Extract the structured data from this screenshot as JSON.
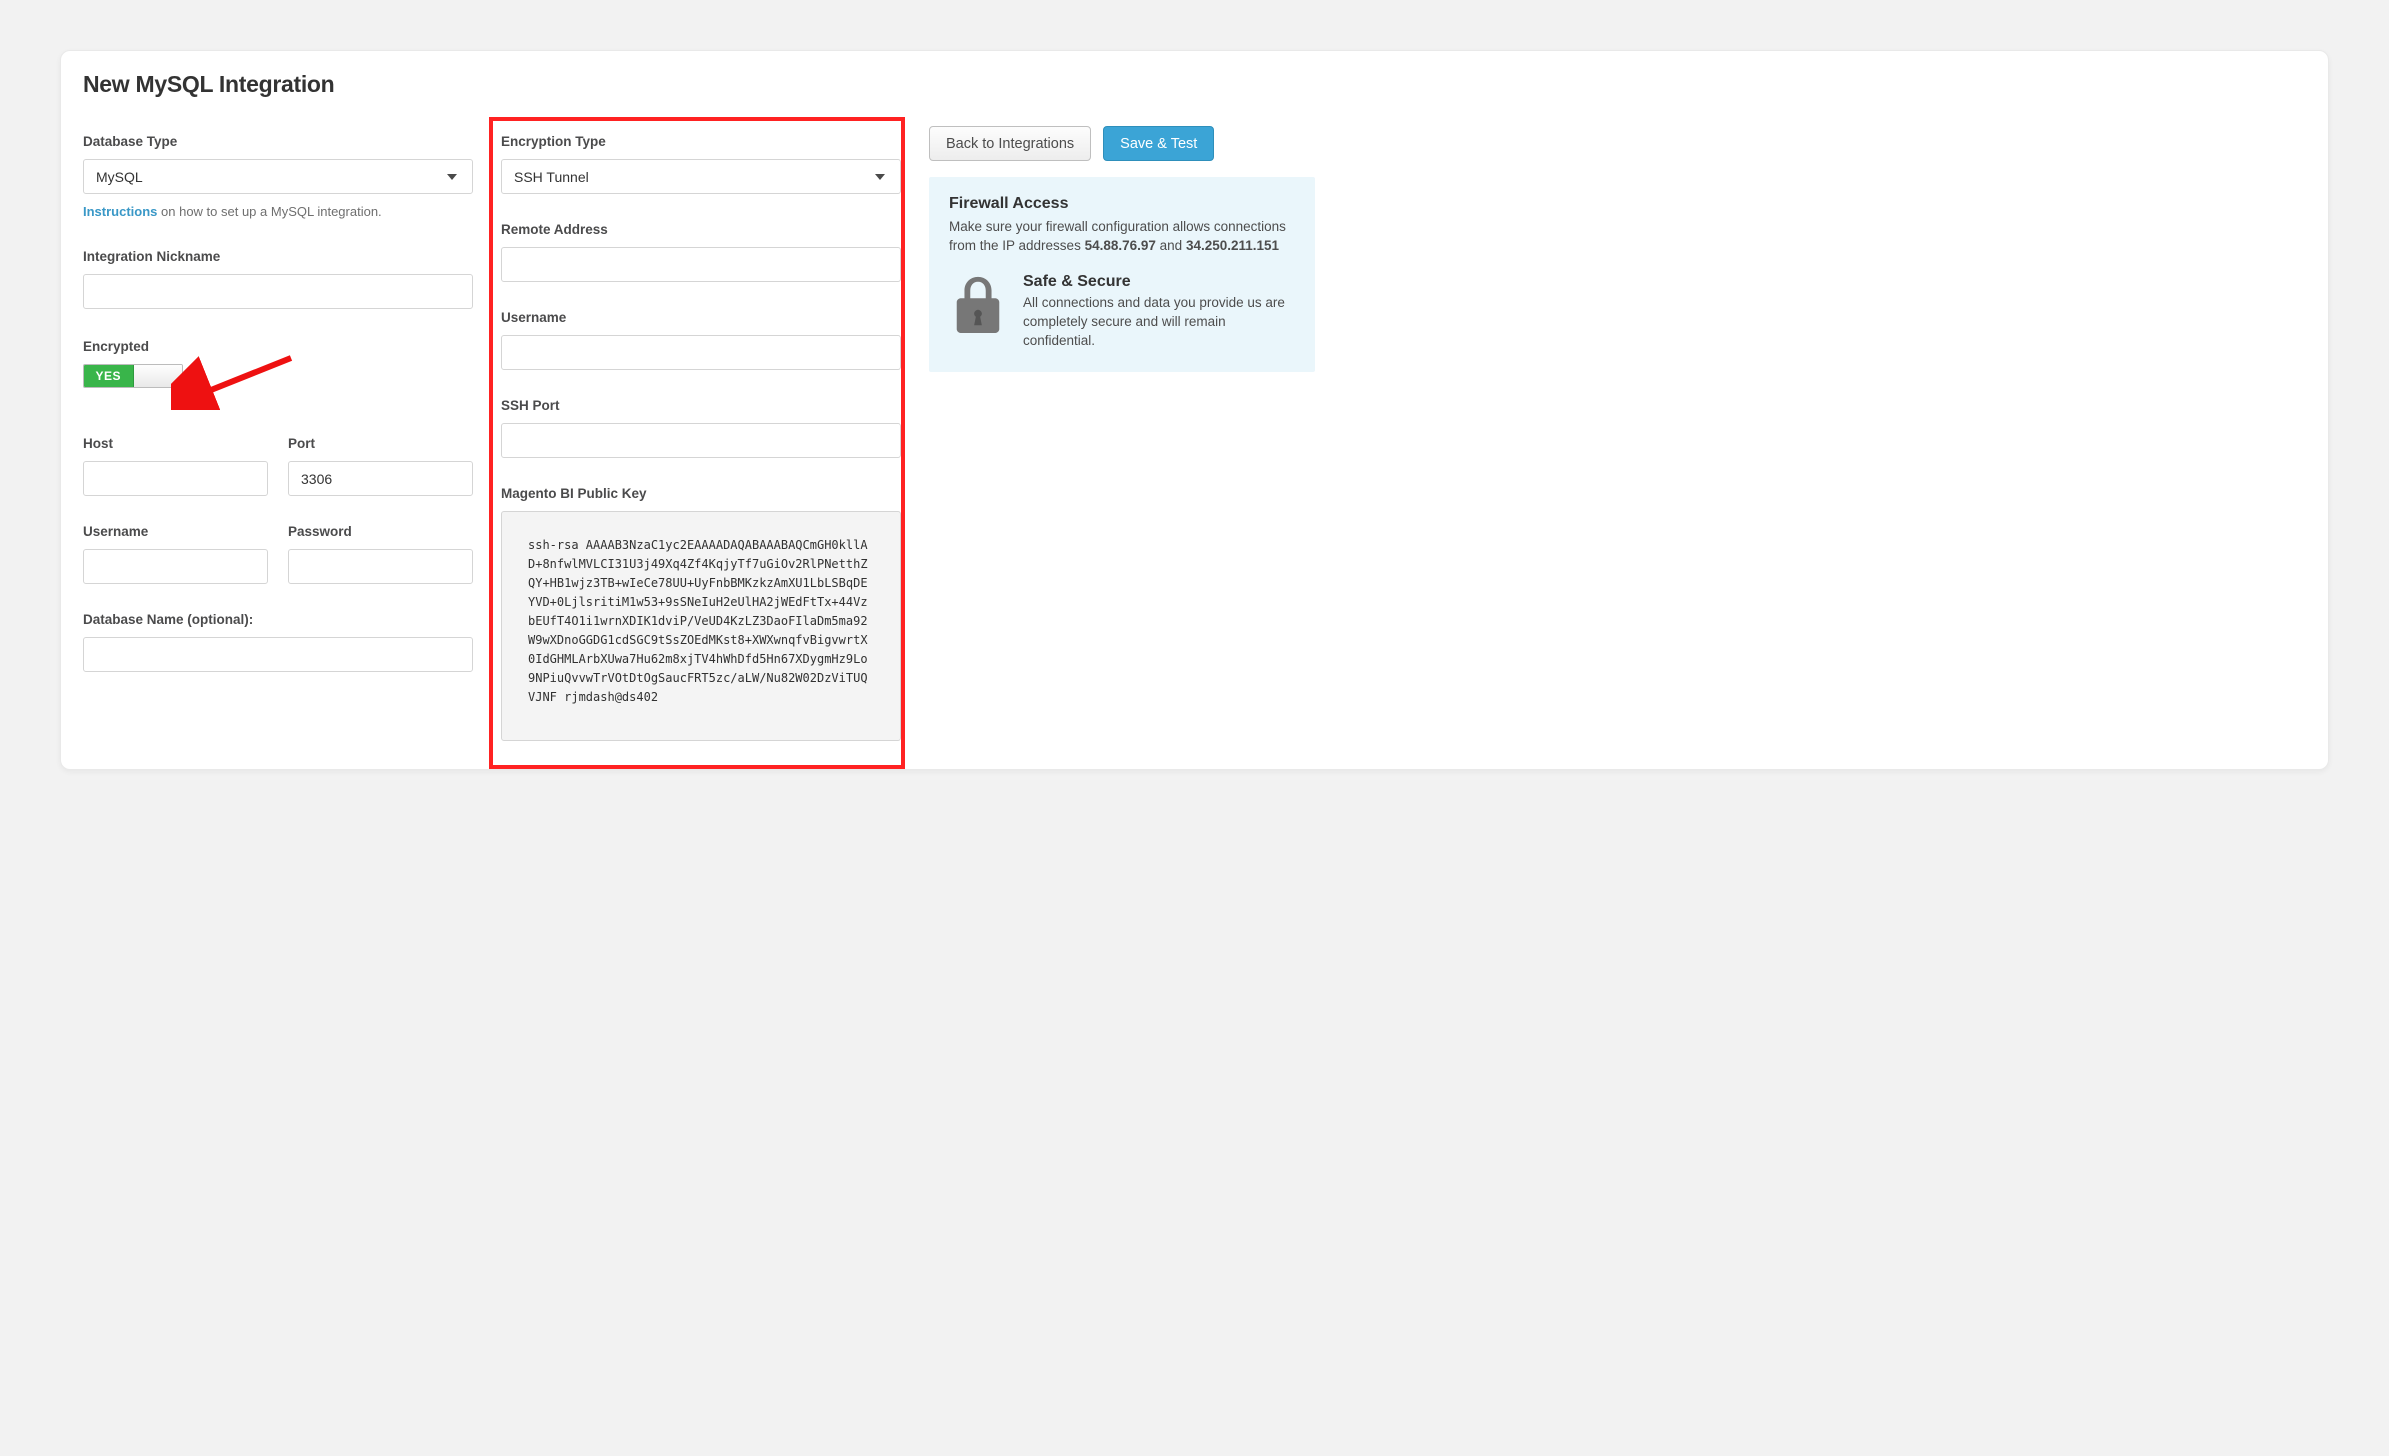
{
  "page": {
    "title": "New MySQL Integration"
  },
  "left": {
    "dbtype_label": "Database Type",
    "dbtype_value": "MySQL",
    "helper_link": "Instructions",
    "helper_text": " on how to set up a MySQL integration.",
    "nickname_label": "Integration Nickname",
    "nickname_value": "",
    "encrypted_label": "Encrypted",
    "toggle_value": "YES",
    "host_label": "Host",
    "host_value": "",
    "port_label": "Port",
    "port_value": "3306",
    "user_label": "Username",
    "user_value": "",
    "pass_label": "Password",
    "pass_value": "",
    "dbname_label": "Database Name (optional):",
    "dbname_value": ""
  },
  "mid": {
    "enc_label": "Encryption Type",
    "enc_value": "SSH Tunnel",
    "remote_label": "Remote Address",
    "remote_value": "",
    "user_label": "Username",
    "user_value": "",
    "sshport_label": "SSH Port",
    "sshport_value": "",
    "pubkey_label": "Magento BI Public Key",
    "pubkey_value": "ssh-rsa AAAAB3NzaC1yc2EAAAADAQABAAABAQCmGH0kllAD+8nfwlMVLCI31U3j49Xq4Zf4KqjyTf7uGiOv2RlPNetthZQY+HB1wjz3TB+wIeCe78UU+UyFnbBMKzkzAmXU1LbLSBqDEYVD+0LjlsritiM1w53+9sSNeIuH2eUlHA2jWEdFtTx+44VzbEUfT4O1i1wrnXDIK1dviP/VeUD4KzLZ3DaoFIlaDm5ma92W9wXDnoGGDG1cdSGC9tSsZOEdMKst8+XWXwnqfvBigvwrtX0IdGHMLArbXUwa7Hu62m8xjTV4hWhDfd5Hn67XDygmHz9Lo9NPiuQvvwTrVOtDtOgSaucFRT5zc/aLW/Nu82W02DzViTUQVJNF rjmdash@ds402"
  },
  "right": {
    "back_btn": "Back to Integrations",
    "save_btn": "Save & Test",
    "fw_title": "Firewall Access",
    "fw_text_pre": "Make sure your firewall configuration allows connections from the IP addresses ",
    "fw_ip1": "54.88.76.97",
    "fw_and": " and ",
    "fw_ip2": "34.250.211.151",
    "secure_title": "Safe & Secure",
    "secure_text": "All connections and data you provide us are completely secure and will remain confidential."
  }
}
